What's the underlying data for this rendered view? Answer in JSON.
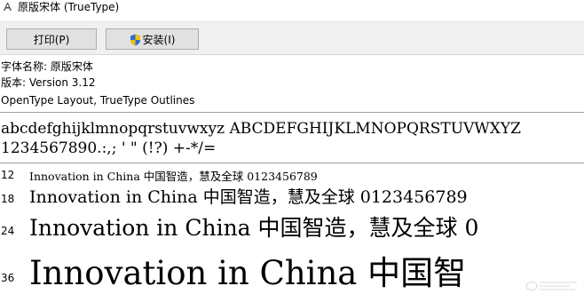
{
  "window": {
    "title": "原版宋体 (TrueType)",
    "icon": "font-file-icon"
  },
  "toolbar": {
    "print_label": "打印(P)",
    "install_label": "安装(I)",
    "install_icon": "uac-shield-icon"
  },
  "info": {
    "font_name_line": "字体名称: 原版宋体",
    "version_line": "版本: Version 3.12",
    "outline_line": "OpenType Layout, TrueType Outlines"
  },
  "charset": {
    "line1": "abcdefghijklmnopqrstuvwxyz ABCDEFGHIJKLMNOPQRSTUVWXYZ",
    "line2": "1234567890.:,; ' \" (!?) +-*/="
  },
  "samples": [
    {
      "size": "12",
      "text": "Innovation in China 中国智造，慧及全球 0123456789"
    },
    {
      "size": "18",
      "text": "Innovation in China 中国智造，慧及全球 0123456789"
    },
    {
      "size": "24",
      "text": "Innovation in China 中国智造，慧及全球 0"
    },
    {
      "size": "36",
      "text": "Innovation in China 中国智"
    }
  ]
}
